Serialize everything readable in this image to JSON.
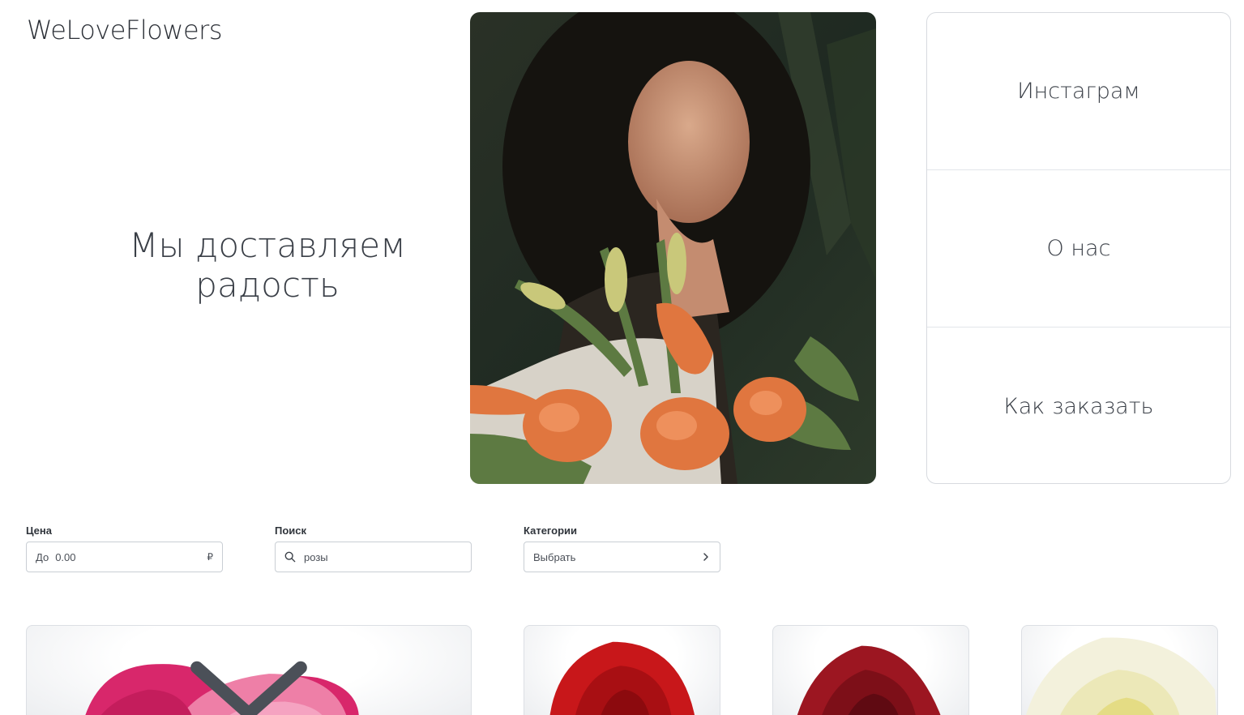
{
  "brand": {
    "name": "WeLoveFlowers"
  },
  "hero": {
    "line1": "Мы доставляем",
    "line2": "радость"
  },
  "nav": {
    "items": [
      {
        "label": "Инстаграм"
      },
      {
        "label": "О нас"
      },
      {
        "label": "Как заказать"
      }
    ]
  },
  "filters": {
    "price": {
      "label": "Цена",
      "prefix": "До",
      "value": "0.00",
      "currency": "₽"
    },
    "search": {
      "label": "Поиск",
      "value": "розы"
    },
    "categories": {
      "label": "Категории",
      "value": "Выбрать"
    }
  },
  "products": [
    {
      "icon": "pink-rose-image"
    },
    {
      "icon": "red-rose-image"
    },
    {
      "icon": "dark-red-rose-image"
    },
    {
      "icon": "white-rose-image"
    }
  ]
}
